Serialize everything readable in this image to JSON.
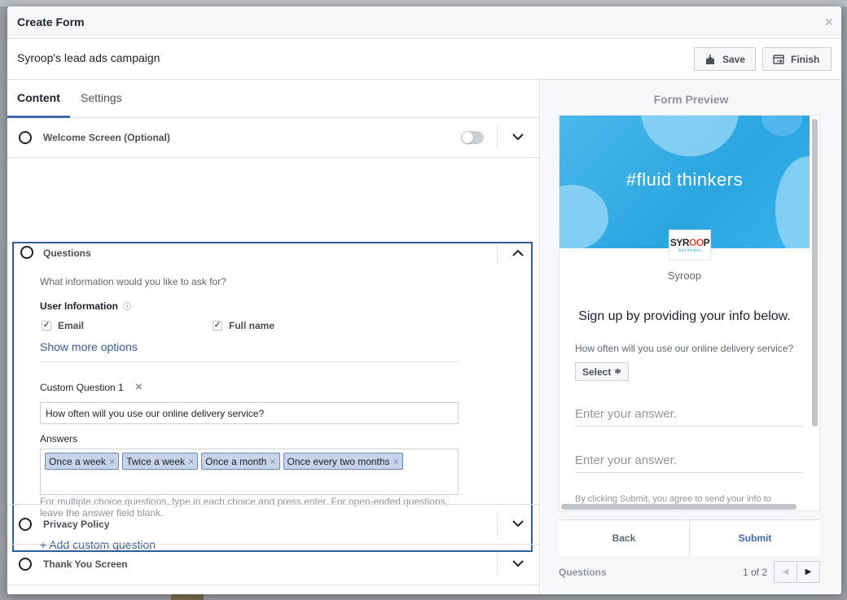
{
  "dialog": {
    "title": "Create Form",
    "close_label": "×",
    "campaign_name": "Syroop's lead ads campaign",
    "save_label": "Save",
    "finish_label": "Finish"
  },
  "tabs": {
    "content": "Content",
    "settings": "Settings"
  },
  "sections": {
    "welcome": "Welcome Screen (Optional)",
    "questions": "Questions",
    "privacy": "Privacy Policy",
    "thank_you": "Thank You Screen"
  },
  "questions": {
    "hint": "What information would you like to ask for?",
    "user_info_label": "User Information",
    "info_glyph": "i",
    "fields": [
      {
        "label": "Email",
        "checked": true
      },
      {
        "label": "Full name",
        "checked": true
      }
    ],
    "check_glyph": "✓",
    "show_more": "Show more options",
    "custom_label": "Custom Question 1",
    "remove_glyph": "×",
    "custom_value": "How often will you use our online delivery service?",
    "answers_label": "Answers",
    "answers": [
      "Once a week",
      "Twice a week",
      "Once a month",
      "Once every two months"
    ],
    "help_text": "For multiple choice questions, type in each choice and press enter. For open-ended questions, leave the answer field blank.",
    "add_custom": "+ Add custom question"
  },
  "preview": {
    "title": "Form Preview",
    "banner_text": "#fluid thinkers",
    "logo_text_a": "SYR",
    "logo_text_b": "OO",
    "logo_text_c": "P",
    "logo_sub": "fluid thinkers",
    "company": "Syroop",
    "headline": "Sign up by providing your info below.",
    "question": "How often will you use our online delivery service?",
    "select_label": "Select",
    "select_glyph": "≑",
    "answer_placeholder": "Enter your answer.",
    "legal": "By clicking Submit, you agree to send your info to",
    "back_label": "Back",
    "submit_label": "Submit",
    "footer_label": "Questions",
    "page_indicator": "1 of 2",
    "prev_glyph": "◀",
    "next_glyph": "▶"
  },
  "colors": {
    "accent": "#4267b2",
    "link": "#365899",
    "section_border": "#2f5f96",
    "chip_bg": "#c6d3e8"
  }
}
